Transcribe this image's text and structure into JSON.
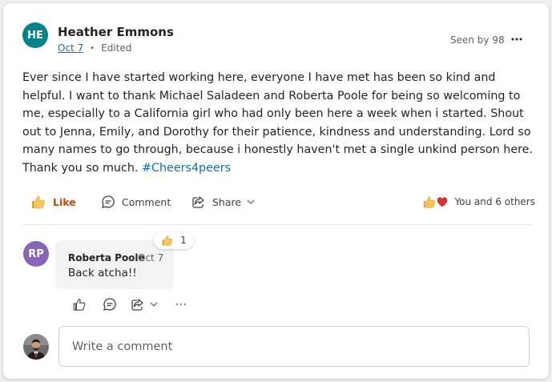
{
  "post": {
    "author_initials": "HE",
    "author_name": "Heather Emmons",
    "date": "Oct 7",
    "edited": "Edited",
    "seen_by": "Seen by 98",
    "body_text": "Ever since I have started working here,  everyone I have met has been so kind and helpful. I want to thank Michael Saladeen and Roberta Poole for being so welcoming to me, especially to a California girl who had only been here a week when i started.  Shout out to Jenna, Emily, and Dorothy for their patience,  kindness and understanding. Lord so many names to go through,  because i honestly haven't met a single unkind person here.\nThank you so much.  ",
    "hashtag": "#Cheers4peers"
  },
  "actions": {
    "like_label": "Like",
    "comment_label": "Comment",
    "share_label": "Share",
    "reactions_summary": "You and 6 others"
  },
  "comment": {
    "author_initials": "RP",
    "author_name": "Roberta Poole",
    "date": "Oct 7",
    "text": "Back atcha!!",
    "reaction_count": "1"
  },
  "composer": {
    "placeholder": "Write a comment"
  },
  "colors": {
    "author_avatar_bg": "#038387",
    "commenter_avatar_bg": "#8764b8",
    "like_accent": "#bc4b09",
    "link_blue": "#0f6cbd",
    "heart_red": "#d13438",
    "thumb_yellow": "#f2c661"
  },
  "icons": {
    "more": "more-horizontal-icon",
    "like": "thumbs-up-icon",
    "comment": "comment-icon",
    "share": "share-icon",
    "chevron": "chevron-down-icon",
    "heart": "heart-icon"
  }
}
